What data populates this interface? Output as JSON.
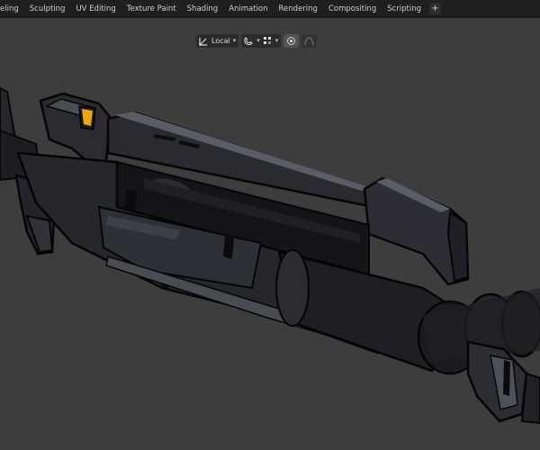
{
  "workspace_tabs": [
    {
      "label": "eling",
      "active": false
    },
    {
      "label": "Sculpting",
      "active": false
    },
    {
      "label": "UV Editing",
      "active": false
    },
    {
      "label": "Texture Paint",
      "active": false
    },
    {
      "label": "Shading",
      "active": false
    },
    {
      "label": "Animation",
      "active": false
    },
    {
      "label": "Rendering",
      "active": false
    },
    {
      "label": "Compositing",
      "active": false
    },
    {
      "label": "Scripting",
      "active": false
    }
  ],
  "add_workspace": "+",
  "viewport_header": {
    "transform_orientation": "Local",
    "transform_pivot_icon": "transform-orientation-icon",
    "snap_icon": "snap-magnet-icon",
    "snap_chev": "▾",
    "snap_increment_icon": "snap-increment-icon",
    "proportional_edit_icon": "proportional-edit-icon",
    "falloff_icon": "falloff-curve-icon"
  },
  "colors": {
    "topbar": "#1f1f1f",
    "viewport_bg": "#3d3d3d",
    "model_dark": "#1e1f23",
    "model_mid": "#2b2d33",
    "model_highlight": "#50535c",
    "accent_yellow": "#e8a516"
  }
}
